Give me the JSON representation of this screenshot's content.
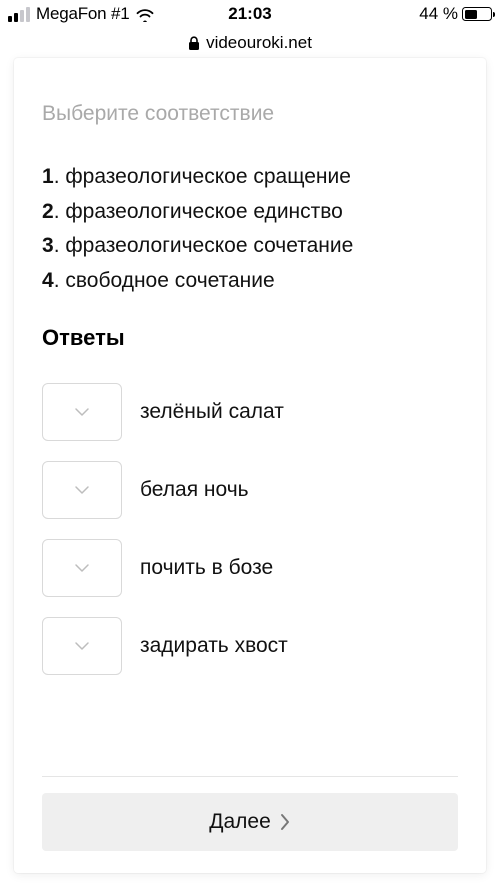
{
  "status": {
    "carrier": "MegaFon #1",
    "time": "21:03",
    "battery_pct": "44 %"
  },
  "browser": {
    "url": "videouroki.net"
  },
  "quiz": {
    "instruction": "Выберите соответствие",
    "definitions": [
      "фразеологическое сращение",
      "фразеологическое единство",
      "фразеологическое сочетание",
      "свободное сочетание"
    ],
    "answers_title": "Ответы",
    "items": [
      "зелёный салат",
      "белая ночь",
      "почить в бозе",
      "задирать хвост"
    ],
    "next_label": "Далее"
  }
}
